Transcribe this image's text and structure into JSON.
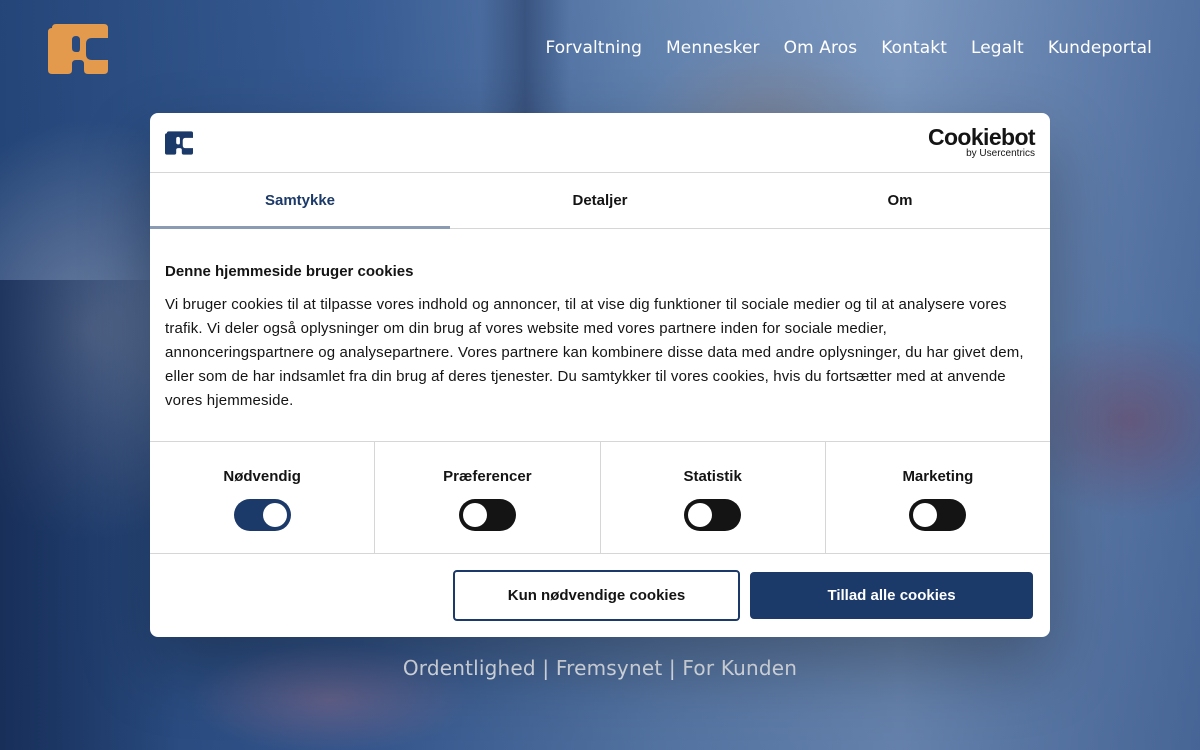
{
  "header": {
    "nav": [
      "Forvaltning",
      "Mennesker",
      "Om Aros",
      "Kontakt",
      "Legalt",
      "Kundeportal"
    ]
  },
  "tagline": "Ordentlighed | Fremsynet | For Kunden",
  "colors": {
    "logo_orange": "#e39a4c",
    "brand_navy": "#1c3a69",
    "toggle_off": "#141414"
  },
  "dialog": {
    "brand": {
      "name": "Cookiebot",
      "sub": "by Usercentrics"
    },
    "tabs": [
      "Samtykke",
      "Detaljer",
      "Om"
    ],
    "active_tab": "Samtykke",
    "title": "Denne hjemmeside bruger cookies",
    "description": "Vi bruger cookies til at tilpasse vores indhold og annoncer, til at vise dig funktioner til sociale medier og til at analysere vores trafik. Vi deler også oplysninger om din brug af vores website med vores partnere inden for sociale medier, annonceringspartnere og analysepartnere. Vores partnere kan kombinere disse data med andre oplysninger, du har givet dem, eller som de har indsamlet fra din brug af deres tjenester. Du samtykker til vores cookies, hvis du fortsætter med at anvende vores hjemmeside.",
    "categories": [
      {
        "label": "Nødvendig",
        "enabled": true
      },
      {
        "label": "Præferencer",
        "enabled": false
      },
      {
        "label": "Statistik",
        "enabled": false
      },
      {
        "label": "Marketing",
        "enabled": false
      }
    ],
    "buttons": {
      "necessary_only": "Kun nødvendige cookies",
      "allow_all": "Tillad alle cookies"
    }
  }
}
